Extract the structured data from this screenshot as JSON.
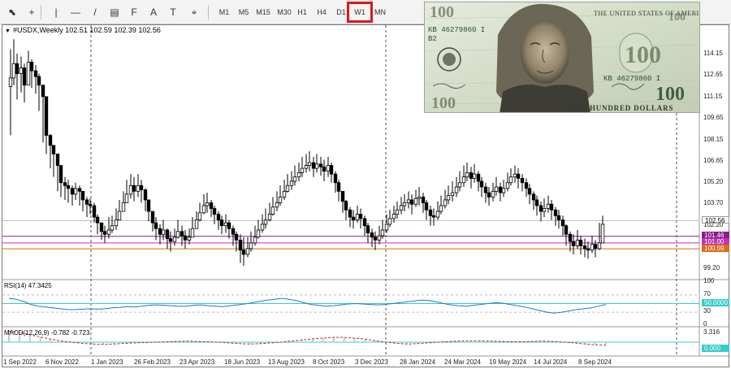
{
  "toolbar": {
    "tools": [
      {
        "name": "cursor-icon",
        "glyph": "⬉"
      },
      {
        "name": "crosshair-icon",
        "glyph": "+"
      },
      {
        "name": "vertical-line-icon",
        "glyph": "|"
      },
      {
        "name": "horizontal-line-icon",
        "glyph": "—"
      },
      {
        "name": "trendline-icon",
        "glyph": "/"
      },
      {
        "name": "channel-icon",
        "glyph": "▤"
      },
      {
        "name": "fibonacci-icon",
        "glyph": "F"
      },
      {
        "name": "text-icon",
        "glyph": "A"
      },
      {
        "name": "text-label-icon",
        "glyph": "T"
      },
      {
        "name": "shapes-icon",
        "glyph": "⌖"
      }
    ],
    "timeframes": [
      "M1",
      "M5",
      "M15",
      "M30",
      "H1",
      "H4",
      "D1",
      "W1",
      "MN"
    ],
    "selected_timeframe": "W1",
    "highlight_color": "#e0141b"
  },
  "chart": {
    "symbol_header": "#USDX,Weekly  102.51 102.59 102.39 102.56",
    "price_labels": [
      "114.15",
      "112.65",
      "111.15",
      "109.65",
      "108.15",
      "106.65",
      "105.20",
      "103.70",
      "102.20",
      "99.20"
    ],
    "current_price": "102.56",
    "levels": [
      {
        "value": "101.46",
        "color": "#8b1a89"
      },
      {
        "value": "101.00",
        "color": "#c030b8"
      },
      {
        "value": "100.59",
        "color": "#e06a10"
      }
    ],
    "x_labels": [
      "1 Sep 2022",
      "6 Nov 2022",
      "1 Jan 2023",
      "26 Feb 2023",
      "23 Apr 2023",
      "18 Jun 2023",
      "13 Aug 2023",
      "8 Oct 2023",
      "3 Dec 2023",
      "28 Jan 2024",
      "24 Mar 2024",
      "19 May 2024",
      "14 Jul 2024",
      "8 Sep 2024"
    ]
  },
  "rsi": {
    "label": "RSI(14) 47.3425",
    "scale": [
      "100",
      "70",
      "30",
      "0"
    ],
    "value_tag": "50.0000",
    "line_color": "#1f78c8",
    "level_color": "#33cccc"
  },
  "macd": {
    "label": "MACD(12,26,9) -0.782 -0.723",
    "scale_top": "3.316",
    "value_tag": "0.000",
    "signal_color": "#cc2020"
  },
  "banknote": {
    "top_text": "THE UNITED STATES OF AMERICA",
    "serial": "KB 46279860 I",
    "serial_prefix": "B2",
    "denomination": "100",
    "bottom_text": "ONE HUNDRED DOLLARS"
  },
  "chart_data": {
    "type": "candlestick",
    "timeframe": "W1",
    "ylim": [
      98.5,
      115.5
    ],
    "levels": [
      101.46,
      101.0,
      100.59
    ],
    "current": 102.56
  }
}
